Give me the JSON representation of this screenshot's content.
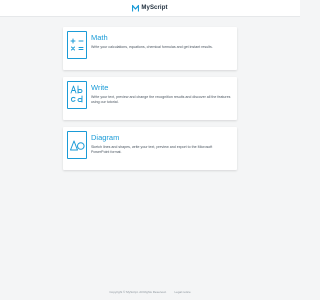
{
  "header": {
    "brand": "MyScript",
    "accent": "#1a9bd7"
  },
  "cards": [
    {
      "icon": "math-operators-icon",
      "title": "Math",
      "description": "Write your calculations, equations, chemical formulas and get instant results."
    },
    {
      "icon": "handwriting-text-icon",
      "title": "Write",
      "description": "Write your text, preview and change the recognition results and discover all the features using our tutorial."
    },
    {
      "icon": "shapes-icon",
      "title": "Diagram",
      "description": "Sketch lines and shapes, write your text, preview and export to the Microsoft PowerPoint format."
    }
  ],
  "footer": {
    "copyright": "Copyright © MyScript. All Rights Reserved.",
    "legal_link": "Legal notice"
  }
}
